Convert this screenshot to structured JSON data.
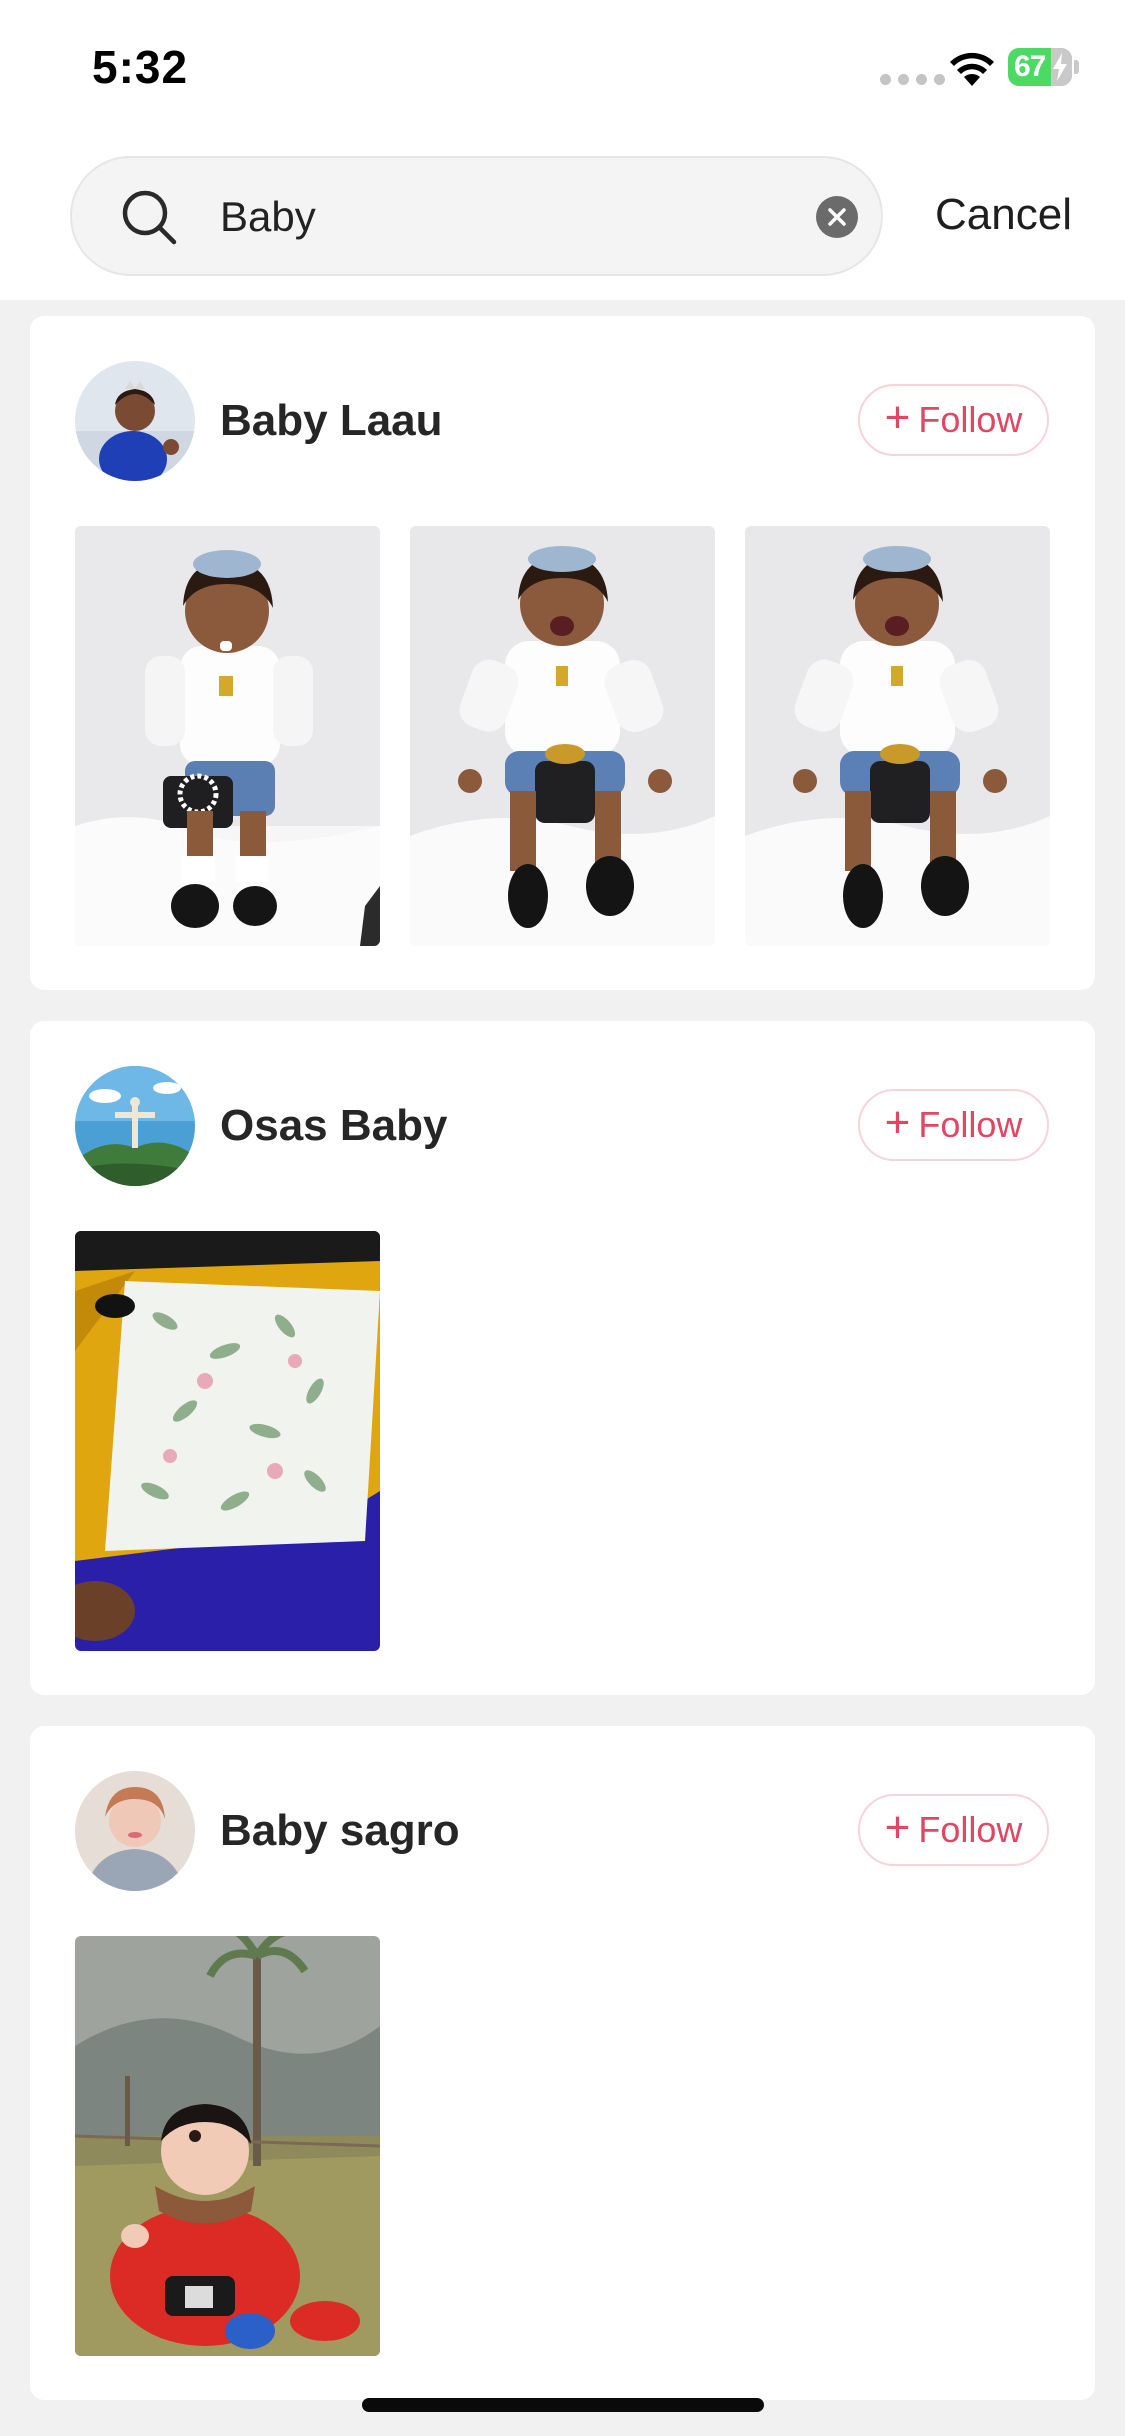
{
  "status_bar": {
    "time": "5:32",
    "battery_percent": "67",
    "battery_charging": true
  },
  "search": {
    "query": "Baby",
    "icon": "search-icon",
    "clear_icon": "clear-icon",
    "cancel_label": "Cancel"
  },
  "results": [
    {
      "name": "Baby Laau",
      "follow_label": "Follow",
      "follow_icon": "plus-icon",
      "photos": [
        "toddler in white shirt with pearl bag",
        "toddler laughing seated",
        "toddler laughing seated"
      ]
    },
    {
      "name": "Osas Baby",
      "follow_label": "Follow",
      "follow_icon": "plus-icon",
      "photos": [
        "floral fabric bag on yellow and blue cloth"
      ]
    },
    {
      "name": "Baby sagro",
      "follow_label": "Follow",
      "follow_icon": "plus-icon",
      "photos": [
        "baby in red coat sitting on grass"
      ]
    }
  ],
  "colors": {
    "accent": "#e04763",
    "follow_border": "#f7d3da",
    "background": "#f1f1f1",
    "card": "#ffffff"
  }
}
